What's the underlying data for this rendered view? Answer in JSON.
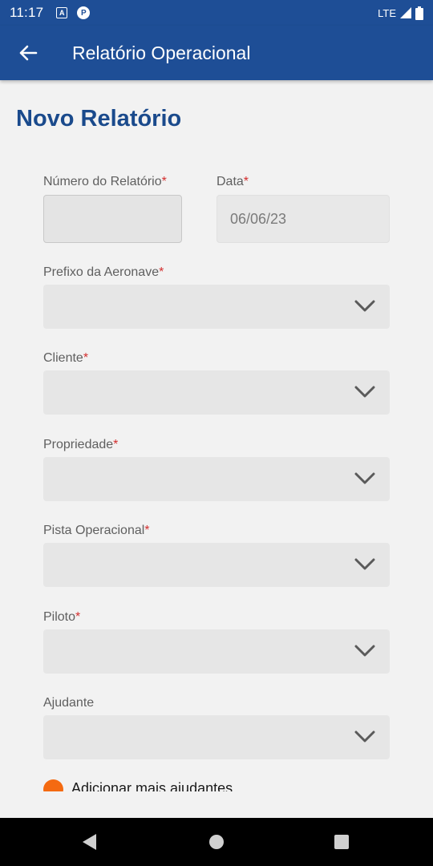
{
  "status_bar": {
    "time": "11:17",
    "network": "LTE"
  },
  "app_bar": {
    "title": "Relatório Operacional"
  },
  "page": {
    "title": "Novo Relatório"
  },
  "form": {
    "numero": {
      "label": "Número do Relatório",
      "required": "*",
      "value": ""
    },
    "data": {
      "label": "Data",
      "required": "*",
      "value": "06/06/23"
    },
    "prefixo": {
      "label": "Prefixo da Aeronave",
      "required": "*"
    },
    "cliente": {
      "label": "Cliente",
      "required": "*"
    },
    "propriedade": {
      "label": "Propriedade",
      "required": "*"
    },
    "pista": {
      "label": "Pista Operacional",
      "required": "*"
    },
    "piloto": {
      "label": "Piloto",
      "required": "*"
    },
    "ajudante": {
      "label": "Ajudante"
    },
    "add_helpers": {
      "label": "Adicionar mais ajudantes"
    }
  },
  "colors": {
    "primary": "#1e4e96",
    "title": "#1a4a8c",
    "required": "#d32f2f",
    "accent": "#f46a11"
  }
}
